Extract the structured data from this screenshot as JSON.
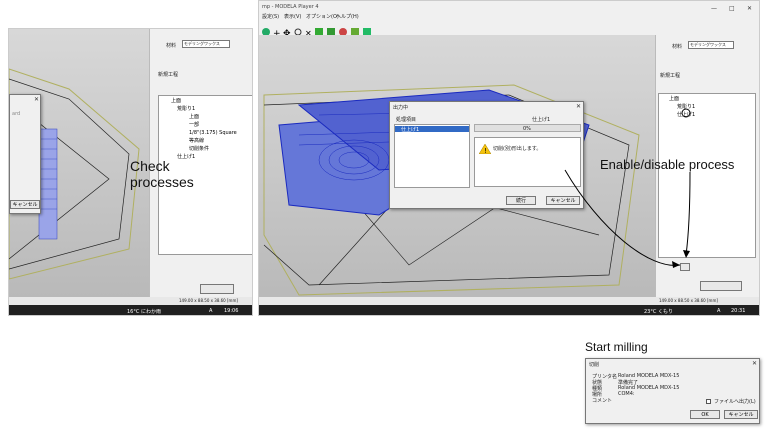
{
  "left_shot": {
    "tree": {
      "root": "上面",
      "process": "荒彫り1",
      "item1": "上面",
      "item2": "一部",
      "tool": "1/8\"(3.175) Square",
      "path": "等高線",
      "cond": "切削条件",
      "finish": "仕上げ1"
    },
    "panel_title": "新規工程",
    "material_label": "材料",
    "material_value": "モデリングワックス",
    "dialog_button": "キャンセル",
    "dialog_text": "ard",
    "status_size": "149.00 x 88.50 x 38.60 [mm]",
    "taskbar": {
      "weather": "16°C にわか雨",
      "time": "19:06",
      "ime": "A"
    }
  },
  "mid_shot": {
    "title": "mp - MODELA Player 4",
    "menu": [
      "設定(S)",
      "表示(V)",
      "オプション(O)",
      "ヘルプ(H)"
    ],
    "dialog": {
      "title": "出力中",
      "col1": "処理項目",
      "col2": "仕上げ1",
      "item": "仕上げ1",
      "percent": "0%",
      "message": "切削(別)形出します。",
      "btn_continue": "続行",
      "btn_cancel": "キャンセル"
    },
    "taskbar": {
      "weather": "23°C くもり",
      "time": "20:31",
      "ime": "A"
    }
  },
  "right_shot": {
    "material_label": "材料",
    "material_value": "モデリングワックス",
    "panel_title": "新規工程",
    "tree": {
      "root": "上面",
      "process": "荒彫り1",
      "finish": "仕上げ1"
    },
    "status_size": "149.00 x 88.50 x 38.60 [mm]"
  },
  "annotations": {
    "check": "Check\nprocesses",
    "enable": "Enable/disable process",
    "start": "Start milling"
  },
  "cut_dialog": {
    "title": "切削",
    "rows": [
      {
        "label": "プリンタ名",
        "value": "Roland MODELA MDX-15"
      },
      {
        "label": "状態",
        "value": "準備完了"
      },
      {
        "label": "種類",
        "value": "Roland MODELA MDX-15"
      },
      {
        "label": "場所",
        "value": "COM4:"
      },
      {
        "label": "コメント",
        "value": ""
      }
    ],
    "file_output": "ファイルへ出力(L)",
    "ok": "OK",
    "cancel": "キャンセル"
  },
  "colors": {
    "accent": "#0000cc",
    "arrow_red": "#cc0000",
    "taskbar": "#202020"
  }
}
